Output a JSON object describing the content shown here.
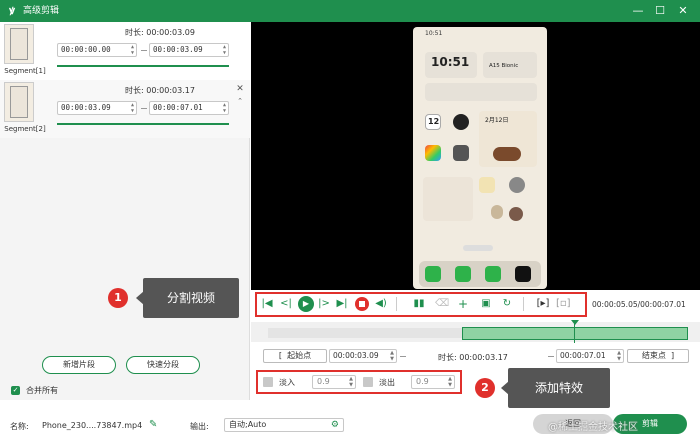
{
  "window": {
    "title": "高级剪辑",
    "logo": "ꝟ",
    "minimize": "—",
    "maximize": "☐",
    "close": "✕"
  },
  "segments": [
    {
      "label": "Segment[1]",
      "duration_label": "时长: 00:00:03.09",
      "start": "00:00:00.00",
      "end": "00:00:03.09"
    },
    {
      "label": "Segment[2]",
      "duration_label": "时长: 00:00:03.17",
      "start": "00:00:03.09",
      "end": "00:00:07.01"
    }
  ],
  "left_buttons": {
    "add_segment": "新增片段",
    "quick_split": "快速分段"
  },
  "merge_all": {
    "label": "合并所有",
    "checked": true
  },
  "phone": {
    "status_time": "10:51",
    "clock": "10:51",
    "date": "2月12日",
    "chip": "A15 Bionic",
    "day": "12"
  },
  "timecode": "00:00:05.05/00:00:07.01",
  "trim": {
    "start_label": "起始点",
    "start_value": "00:00:03.09",
    "duration_label": "时长: 00:00:03.17",
    "end_value": "00:00:07.01",
    "end_label": "结束点"
  },
  "effects": {
    "fade_in_label": "淡入",
    "fade_in_value": "0.9",
    "fade_out_label": "淡出",
    "fade_out_value": "0.9"
  },
  "annotations": [
    {
      "number": "1",
      "text": "分割视频"
    },
    {
      "number": "2",
      "text": "添加特效"
    }
  ],
  "bottom": {
    "name_label": "名称:",
    "name_value": "Phone_230....73847.mp4",
    "output_label": "输出:",
    "output_value": "自动;Auto",
    "back_button": "返回",
    "cut_button": "剪辑",
    "watermark": "@稀土掘金技术社区"
  },
  "colors": {
    "accent": "#1f8f4e",
    "annotation": "#e0302c"
  }
}
